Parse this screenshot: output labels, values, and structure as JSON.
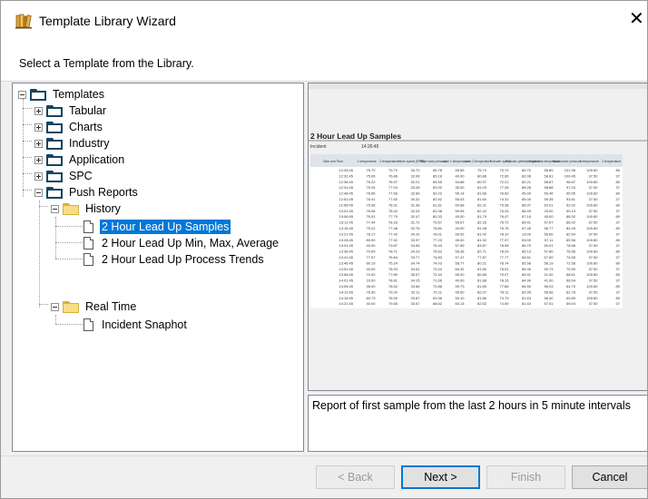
{
  "window": {
    "title": "Template Library Wizard",
    "close_glyph": "✕",
    "header_text": "Select a Template from the Library."
  },
  "tree": {
    "root": "Templates",
    "tabular": "Tabular",
    "charts": "Charts",
    "industry": "Industry",
    "application": "Application",
    "spc": "SPC",
    "push_reports": "Push Reports",
    "history": "History",
    "history_items": [
      "2 Hour Lead Up Samples",
      "2 Hour Lead Up Min, Max, Average",
      "2 Hour Lead Up Process Trends"
    ],
    "real_time": "Real Time",
    "real_time_items": [
      "Incident Snaphot"
    ],
    "selected": "2 Hour Lead Up Samples"
  },
  "preview": {
    "report_title": "2 Hour Lead Up Samples",
    "incident_label": "Incident",
    "incident_time": "14:26:45",
    "columns": [
      "Date and Time",
      "1 temperature",
      "2 temperature",
      "Mixer speed (RPM)",
      "Mixer tank pressure",
      "zone 1 temperature",
      "zone 2 temperature",
      "Extruder speed",
      "Extruder pelletizer speed",
      "Batch tank temperature",
      "Batch mixer pressure",
      "1 temperature",
      "2 temperature"
    ],
    "rows": [
      [
        "12:26:45",
        "75.70",
        "75.70",
        "30.70",
        "85.78",
        "55.69",
        "75.70",
        "70.70",
        "80.70",
        "55.89",
        "101.96",
        "100.80",
        "80"
      ],
      [
        "12:31:45",
        "75.06",
        "76.86",
        "32.06",
        "85.18",
        "40.00",
        "80.86",
        "72.06",
        "82.06",
        "58.81",
        "100.45",
        "37.50",
        "37"
      ],
      [
        "12:36:45",
        "76.22",
        "76.97",
        "32.21",
        "84.55",
        "54.86",
        "80.97",
        "72.21",
        "82.21",
        "58.87",
        "98.87",
        "100.80",
        "80"
      ],
      [
        "12:41:45",
        "75.26",
        "77.03",
        "33.28",
        "83.90",
        "35.00",
        "81.03",
        "77.28",
        "88.28",
        "58.88",
        "97.24",
        "37.50",
        "37"
      ],
      [
        "12:46:45",
        "76.56",
        "77.66",
        "32.89",
        "83.22",
        "55.14",
        "81.66",
        "76.89",
        "45.00",
        "59.46",
        "95.55",
        "100.80",
        "80"
      ],
      [
        "12:51:45",
        "76.41",
        "77.60",
        "30.31",
        "82.52",
        "55.03",
        "81.60",
        "74.31",
        "85.00",
        "59.35",
        "93.81",
        "37.50",
        "37"
      ],
      [
        "12:56:45",
        "75.98",
        "78.31",
        "31.38",
        "81.81",
        "59.88",
        "82.31",
        "75.38",
        "86.07",
        "60.01",
        "92.02",
        "100.80",
        "80"
      ],
      [
        "13:01:45",
        "76.08",
        "78.42",
        "32.24",
        "81.08",
        "59.95",
        "82.42",
        "76.24",
        "86.93",
        "25.00",
        "90.19",
        "37.50",
        "37"
      ],
      [
        "13:06:45",
        "76.51",
        "77.79",
        "32.47",
        "80.33",
        "40.00",
        "81.79",
        "76.47",
        "87.16",
        "45.00",
        "88.32",
        "100.80",
        "80"
      ],
      [
        "13:11:45",
        "77.44",
        "78.33",
        "31.72",
        "79.57",
        "55.67",
        "82.33",
        "75.72",
        "86.41",
        "57.67",
        "86.42",
        "37.50",
        "37"
      ],
      [
        "13:16:45",
        "75.22",
        "77.48",
        "32.76",
        "78.80",
        "40.00",
        "81.48",
        "76.76",
        "87.45",
        "56.77",
        "84.49",
        "100.80",
        "80"
      ],
      [
        "13:21:45",
        "78.17",
        "77.42",
        "34.10",
        "78.01",
        "59.02",
        "81.42",
        "78.10",
        "13.00",
        "56.60",
        "82.54",
        "37.50",
        "37"
      ],
      [
        "13:26:45",
        "80.90",
        "77.92",
        "33.97",
        "77.23",
        "45.00",
        "81.92",
        "77.97",
        "53.00",
        "57.11",
        "80.56",
        "100.80",
        "80"
      ],
      [
        "13:31:45",
        "40.00",
        "79.87",
        "34.95",
        "76.43",
        "57.59",
        "83.87",
        "78.95",
        "85.79",
        "59.01",
        "78.58",
        "37.50",
        "37"
      ],
      [
        "13:36:45",
        "70.00",
        "78.71",
        "34.29",
        "75.63",
        "56.38",
        "82.71",
        "78.29",
        "85.13",
        "57.80",
        "76.58",
        "100.80",
        "80"
      ],
      [
        "13:41:45",
        "77.57",
        "76.84",
        "33.77",
        "74.83",
        "57.47",
        "77.87",
        "77.77",
        "84.61",
        "57.89",
        "74.58",
        "37.50",
        "37"
      ],
      [
        "13:46:45",
        "80.19",
        "75.24",
        "34.74",
        "74.03",
        "58.77",
        "80.21",
        "78.74",
        "85.58",
        "58.19",
        "72.58",
        "100.80",
        "80"
      ],
      [
        "13:51:45",
        "40.00",
        "78.93",
        "34.51",
        "73.24",
        "60.32",
        "81.80",
        "78.51",
        "85.35",
        "59.73",
        "70.59",
        "37.50",
        "37"
      ],
      [
        "13:56:45",
        "70.00",
        "77.89",
        "35.07",
        "72.44",
        "55.00",
        "80.85",
        "79.07",
        "85.91",
        "21.00",
        "68.61",
        "100.80",
        "80"
      ],
      [
        "14:01:45",
        "16.00",
        "78.81",
        "34.15",
        "71.66",
        "40.00",
        "81.88",
        "78.15",
        "84.99",
        "41.00",
        "66.64",
        "37.50",
        "37"
      ],
      [
        "14:06:45",
        "46.00",
        "78.52",
        "33.66",
        "70.88",
        "59.73",
        "81.89",
        "77.66",
        "84.50",
        "56.03",
        "64.70",
        "100.80",
        "80"
      ],
      [
        "14:11:45",
        "76.00",
        "79.20",
        "32.11",
        "70.11",
        "45.00",
        "82.07",
        "76.11",
        "82.95",
        "56.66",
        "62.78",
        "37.50",
        "37"
      ],
      [
        "14:16:45",
        "80.73",
        "78.99",
        "33.87",
        "69.36",
        "55.10",
        "81.86",
        "74.79",
        "81.63",
        "56.40",
        "60.89",
        "100.80",
        "80"
      ],
      [
        "14:21:45",
        "40.00",
        "79.65",
        "33.67",
        "68.62",
        "60.13",
        "82.52",
        "74.59",
        "81.43",
        "57.01",
        "59.04",
        "37.50",
        "37"
      ]
    ]
  },
  "description": "Report of first sample from the last 2 hours in 5 minute intervals",
  "buttons": {
    "back": "< Back",
    "next": "Next >",
    "finish": "Finish",
    "cancel": "Cancel"
  }
}
